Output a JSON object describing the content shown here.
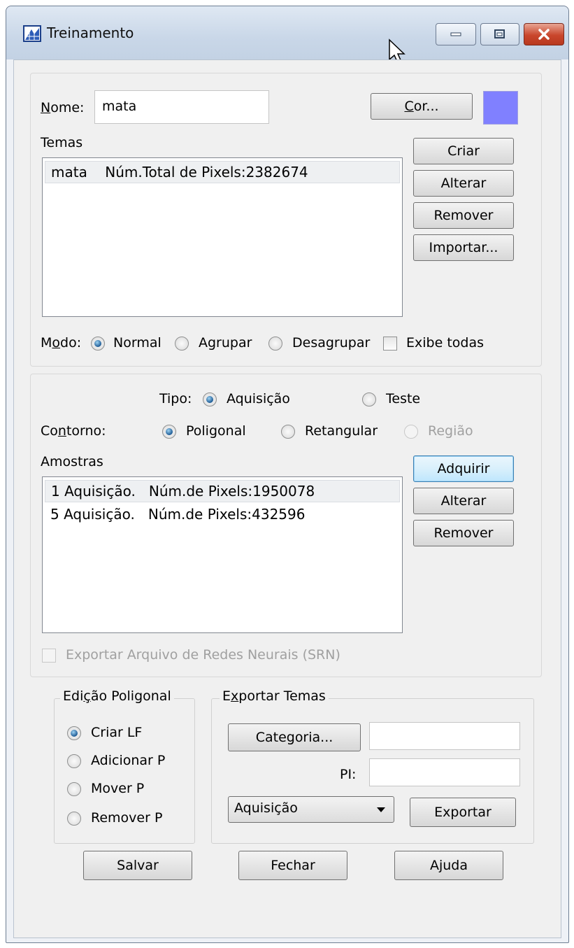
{
  "window": {
    "title": "Treinamento",
    "swatch_color": "#8080ff"
  },
  "temas": {
    "nome_label": "Nome:",
    "nome_value": "mata",
    "cor_button": "Cor...",
    "list_label": "Temas",
    "items": [
      "mata    Núm.Total de Pixels:2382674"
    ],
    "buttons": {
      "criar": "Criar",
      "alterar": "Alterar",
      "remover": "Remover",
      "importar": "Importar..."
    },
    "modo_label": "Modo:",
    "modo_options": {
      "normal": "Normal",
      "agrupar": "Agrupar",
      "desagrupar": "Desagrupar"
    },
    "modo_selected": "Normal",
    "exibe_todas": "Exibe todas"
  },
  "amostras": {
    "tipo_label": "Tipo:",
    "tipo_options": {
      "aquisicao": "Aquisição",
      "teste": "Teste"
    },
    "tipo_selected": "Aquisição",
    "contorno_label": "Contorno:",
    "contorno_options": {
      "poligonal": "Poligonal",
      "retangular": "Retangular",
      "regiao": "Região"
    },
    "contorno_selected": "Poligonal",
    "list_label": "Amostras",
    "items": [
      "1 Aquisição.   Núm.de Pixels:1950078",
      "5 Aquisição.   Núm.de Pixels:432596"
    ],
    "buttons": {
      "adquirir": "Adquirir",
      "alterar": "Alterar",
      "remover": "Remover"
    },
    "exportar_srn": "Exportar Arquivo de Redes Neurais (SRN)"
  },
  "edicao": {
    "title": "Edição Poligonal",
    "options": {
      "criar": "Criar LF",
      "adicionar": "Adicionar P",
      "mover": "Mover P",
      "remover": "Remover P"
    },
    "selected": "Criar LF"
  },
  "exportar": {
    "title": "Exportar Temas",
    "categoria_button": "Categoria...",
    "categoria_value": "",
    "pi_label": "PI:",
    "pi_value": "",
    "combo_value": "Aquisição",
    "exportar_button": "Exportar"
  },
  "footer": {
    "salvar": "Salvar",
    "fechar": "Fechar",
    "ajuda": "Ajuda"
  }
}
